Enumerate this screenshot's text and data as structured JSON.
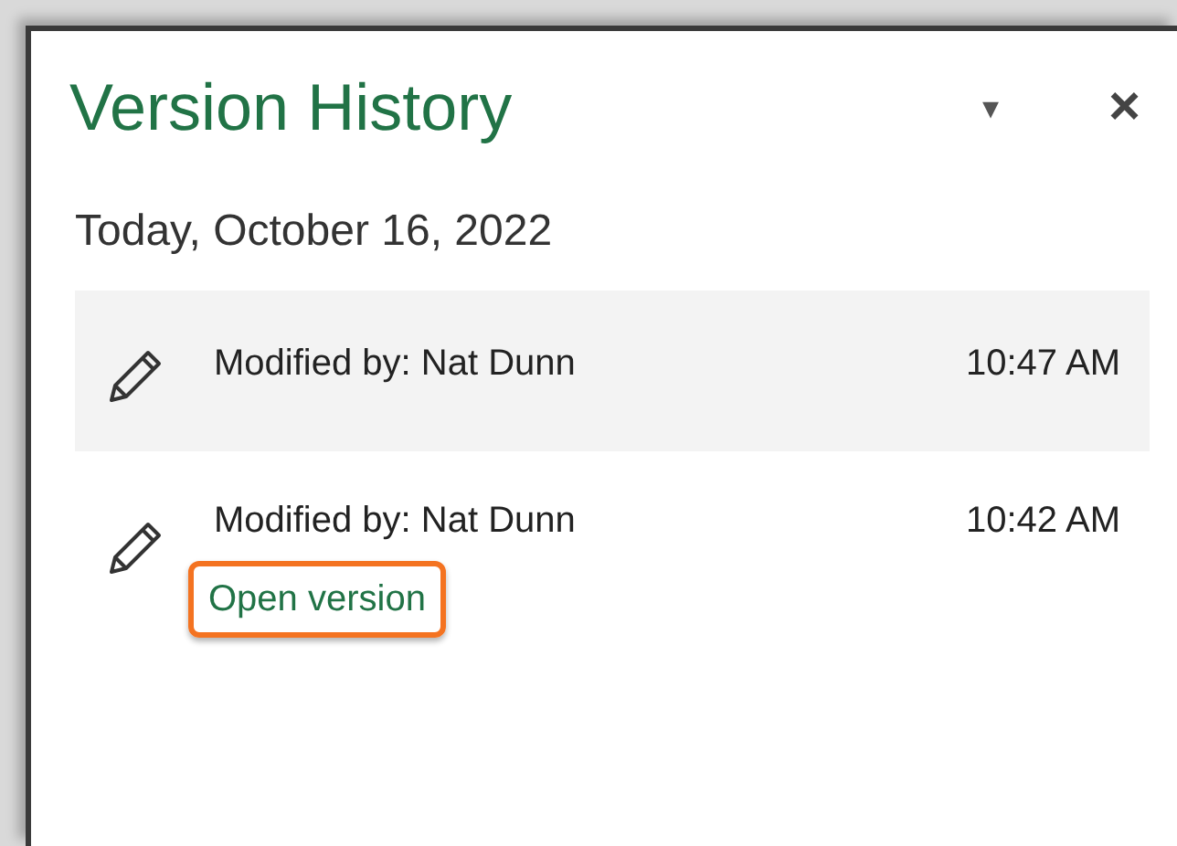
{
  "panel": {
    "title": "Version History",
    "menu_glyph": "▾",
    "close_glyph": "×"
  },
  "date_heading": "Today, October 16, 2022",
  "versions": [
    {
      "text": "Modified by: Nat Dunn",
      "time": "10:47 AM",
      "selected": true
    },
    {
      "text": "Modified by: Nat Dunn",
      "time": "10:42 AM",
      "selected": false,
      "action": {
        "label": "Open version",
        "outlined": true
      }
    }
  ]
}
